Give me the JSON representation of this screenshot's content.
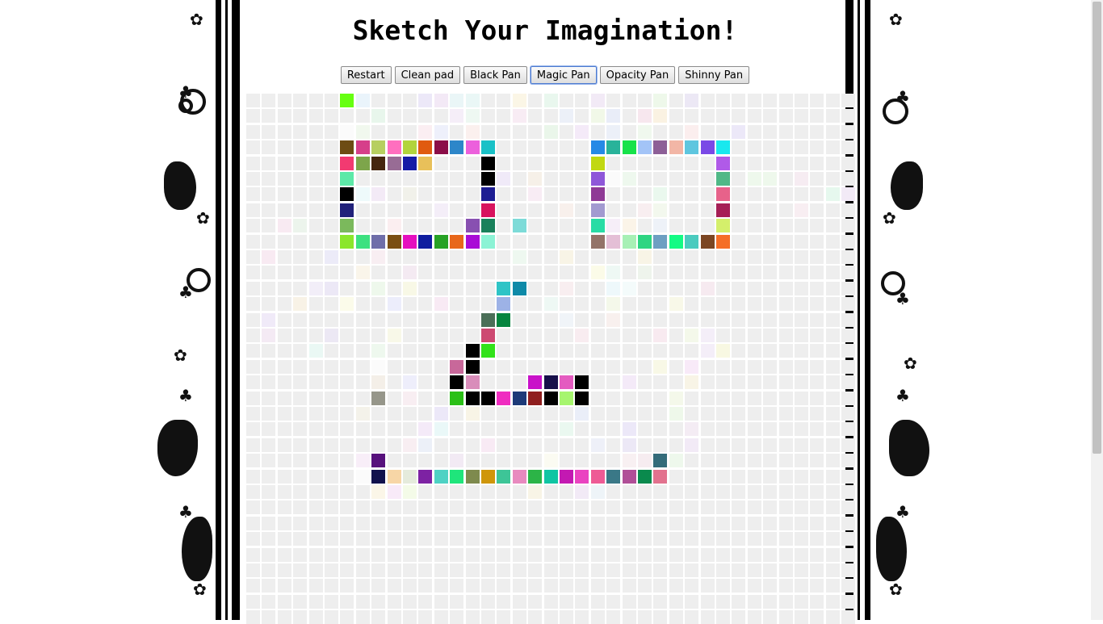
{
  "title": "Sketch Your Imagination!",
  "toolbar": {
    "restart_label": "Restart",
    "clean_label": "Clean pad",
    "black_label": "Black Pan",
    "magic_label": "Magic Pan",
    "opacity_label": "Opacity Pan",
    "shinny_label": "Shinny Pan",
    "active": "magic"
  },
  "grid": {
    "rows": 34,
    "cols": 39,
    "empty_color": "#eeeeee",
    "painted": [
      [
        0,
        6,
        "#66ff11"
      ],
      [
        3,
        6,
        "#6d4c13"
      ],
      [
        3,
        7,
        "#d63f8a"
      ],
      [
        3,
        8,
        "#b7cf60"
      ],
      [
        3,
        9,
        "#ff6fbf"
      ],
      [
        3,
        10,
        "#b2d43c"
      ],
      [
        3,
        11,
        "#e05a10"
      ],
      [
        3,
        12,
        "#8b0d48"
      ],
      [
        3,
        13,
        "#2d86c9"
      ],
      [
        3,
        14,
        "#ec60dc"
      ],
      [
        3,
        15,
        "#19c1c7"
      ],
      [
        3,
        22,
        "#2589e6"
      ],
      [
        3,
        23,
        "#29b39a"
      ],
      [
        3,
        24,
        "#16e24a"
      ],
      [
        3,
        25,
        "#a3c4f7"
      ],
      [
        3,
        26,
        "#8d5f97"
      ],
      [
        3,
        27,
        "#f2b6a6"
      ],
      [
        3,
        28,
        "#5ec6df"
      ],
      [
        3,
        29,
        "#7a49e6"
      ],
      [
        3,
        30,
        "#19e8ee"
      ],
      [
        4,
        6,
        "#f23a71"
      ],
      [
        4,
        7,
        "#7da54b"
      ],
      [
        4,
        8,
        "#45260f"
      ],
      [
        4,
        9,
        "#986c95"
      ],
      [
        4,
        10,
        "#161aa6"
      ],
      [
        4,
        11,
        "#e8c05a"
      ],
      [
        4,
        15,
        "#000000"
      ],
      [
        4,
        22,
        "#c1d811"
      ],
      [
        4,
        30,
        "#b05ae8"
      ],
      [
        5,
        6,
        "#5de9a8"
      ],
      [
        5,
        15,
        "#000000"
      ],
      [
        5,
        22,
        "#8f57d9"
      ],
      [
        5,
        30,
        "#50b887"
      ],
      [
        6,
        6,
        "#000000"
      ],
      [
        6,
        15,
        "#1d1d93"
      ],
      [
        6,
        22,
        "#8f3a96"
      ],
      [
        6,
        30,
        "#e7628a"
      ],
      [
        7,
        6,
        "#21217a"
      ],
      [
        7,
        15,
        "#d8135e"
      ],
      [
        7,
        22,
        "#a29ad0"
      ],
      [
        7,
        30,
        "#a61f56"
      ],
      [
        8,
        6,
        "#7bb95c"
      ],
      [
        8,
        14,
        "#8850b1"
      ],
      [
        8,
        15,
        "#19815b"
      ],
      [
        8,
        17,
        "#7ddbd8"
      ],
      [
        8,
        22,
        "#29dca5"
      ],
      [
        8,
        30,
        "#d4ef6b"
      ],
      [
        9,
        6,
        "#8be62b"
      ],
      [
        9,
        7,
        "#3de180"
      ],
      [
        9,
        8,
        "#6f6ea9"
      ],
      [
        9,
        9,
        "#7a4e12"
      ],
      [
        9,
        10,
        "#e50fbf"
      ],
      [
        9,
        11,
        "#0f1d9f"
      ],
      [
        9,
        12,
        "#27a225"
      ],
      [
        9,
        13,
        "#e8671a"
      ],
      [
        9,
        14,
        "#a90bd6"
      ],
      [
        9,
        15,
        "#8cf3d5"
      ],
      [
        9,
        22,
        "#937368"
      ],
      [
        9,
        23,
        "#e4bfd6"
      ],
      [
        9,
        24,
        "#a7f0b5"
      ],
      [
        9,
        25,
        "#2ed582"
      ],
      [
        9,
        26,
        "#6d9fc2"
      ],
      [
        9,
        27,
        "#14fb84"
      ],
      [
        9,
        28,
        "#4bcbbf"
      ],
      [
        9,
        29,
        "#7c4622"
      ],
      [
        9,
        30,
        "#f56e26"
      ],
      [
        12,
        16,
        "#2ec4c6"
      ],
      [
        12,
        17,
        "#0e8aa8"
      ],
      [
        13,
        16,
        "#9db2e6"
      ],
      [
        14,
        15,
        "#4b6f58"
      ],
      [
        14,
        16,
        "#06853f"
      ],
      [
        15,
        15,
        "#cd4a72"
      ],
      [
        16,
        14,
        "#000000"
      ],
      [
        16,
        15,
        "#32e21a"
      ],
      [
        17,
        13,
        "#c8689a"
      ],
      [
        17,
        14,
        "#000000"
      ],
      [
        18,
        13,
        "#000000"
      ],
      [
        18,
        14,
        "#d98dba"
      ],
      [
        18,
        18,
        "#c912c9"
      ],
      [
        18,
        19,
        "#170f4a"
      ],
      [
        18,
        20,
        "#e45bc0"
      ],
      [
        18,
        21,
        "#000000"
      ],
      [
        19,
        8,
        "#96968a"
      ],
      [
        19,
        13,
        "#2bc017"
      ],
      [
        19,
        14,
        "#000000"
      ],
      [
        19,
        15,
        "#000000"
      ],
      [
        19,
        16,
        "#ef2cc0"
      ],
      [
        19,
        17,
        "#1d3a78"
      ],
      [
        19,
        18,
        "#8f1e1e"
      ],
      [
        19,
        19,
        "#000000"
      ],
      [
        19,
        20,
        "#a6f56e"
      ],
      [
        19,
        21,
        "#000000"
      ],
      [
        23,
        8,
        "#57117c"
      ],
      [
        23,
        26,
        "#346c7a"
      ],
      [
        24,
        8,
        "#12124d"
      ],
      [
        24,
        9,
        "#f7d6a6"
      ],
      [
        24,
        10,
        "#e5ebdc"
      ],
      [
        24,
        11,
        "#7d22a3"
      ],
      [
        24,
        12,
        "#4ed2c4"
      ],
      [
        24,
        13,
        "#1fe57b"
      ],
      [
        24,
        14,
        "#7e8a4e"
      ],
      [
        24,
        15,
        "#cf960a"
      ],
      [
        24,
        16,
        "#3dc597"
      ],
      [
        24,
        17,
        "#e88abf"
      ],
      [
        24,
        18,
        "#2cb447"
      ],
      [
        24,
        19,
        "#10c5a3"
      ],
      [
        24,
        20,
        "#c319b2"
      ],
      [
        24,
        21,
        "#ea43c1"
      ],
      [
        24,
        22,
        "#ee5b95"
      ],
      [
        24,
        23,
        "#3a7887"
      ],
      [
        24,
        24,
        "#b04f97"
      ],
      [
        24,
        25,
        "#0a8a4d"
      ],
      [
        24,
        26,
        "#e2728e"
      ]
    ],
    "faint": [
      [
        0,
        7,
        "#eaf4fb"
      ],
      [
        0,
        11,
        "#ece8f8"
      ],
      [
        0,
        12,
        "#f3e9f6"
      ],
      [
        0,
        13,
        "#eaf6f7"
      ],
      [
        0,
        14,
        "#eaf7f6"
      ],
      [
        0,
        17,
        "#fbf6e6"
      ],
      [
        0,
        19,
        "#e9f7ee"
      ],
      [
        0,
        22,
        "#f2eaf6"
      ],
      [
        0,
        26,
        "#eef8ea"
      ],
      [
        0,
        28,
        "#ece8f5"
      ],
      [
        1,
        8,
        "#e8f6ec"
      ],
      [
        1,
        13,
        "#f5eef8"
      ],
      [
        1,
        14,
        "#eef8f2"
      ],
      [
        1,
        17,
        "#f8ecf4"
      ],
      [
        1,
        20,
        "#ecf0f8"
      ],
      [
        1,
        22,
        "#f1f8e8"
      ],
      [
        1,
        23,
        "#e9edf8"
      ],
      [
        1,
        25,
        "#f7e7ee"
      ],
      [
        1,
        26,
        "#faf2e2"
      ],
      [
        2,
        6,
        "#fbfbfb"
      ],
      [
        2,
        7,
        "#f1f8ee"
      ],
      [
        2,
        11,
        "#fbeef2"
      ],
      [
        2,
        12,
        "#eef0fb"
      ],
      [
        2,
        14,
        "#fbf0ee"
      ],
      [
        2,
        19,
        "#eaf6ea"
      ],
      [
        2,
        21,
        "#f4eaf8"
      ],
      [
        2,
        23,
        "#ecf0f8"
      ],
      [
        2,
        25,
        "#f0f8ee"
      ],
      [
        2,
        28,
        "#fbeeee"
      ],
      [
        2,
        31,
        "#ece8f8"
      ],
      [
        5,
        16,
        "#f0eaf8"
      ],
      [
        5,
        18,
        "#f6f0e8"
      ],
      [
        5,
        23,
        "#fbfbfb"
      ],
      [
        5,
        24,
        "#eef8ee"
      ],
      [
        5,
        32,
        "#eef8ec"
      ],
      [
        5,
        33,
        "#eef8ec"
      ],
      [
        5,
        35,
        "#f6ecf2"
      ],
      [
        6,
        7,
        "#eefafb"
      ],
      [
        6,
        8,
        "#f3eaf6"
      ],
      [
        6,
        10,
        "#f1f1ea"
      ],
      [
        6,
        18,
        "#f8ecf4"
      ],
      [
        6,
        26,
        "#eaf8ee"
      ],
      [
        6,
        37,
        "#e6f8ee"
      ],
      [
        6,
        38,
        "#f2eaf6"
      ],
      [
        7,
        12,
        "#f4eef8"
      ],
      [
        7,
        20,
        "#f8f0ec"
      ],
      [
        7,
        25,
        "#f8eef0"
      ],
      [
        7,
        26,
        "#f3f8ee"
      ],
      [
        7,
        35,
        "#f8eef2"
      ],
      [
        8,
        2,
        "#f8eaf2"
      ],
      [
        8,
        3,
        "#ecf4ec"
      ],
      [
        8,
        9,
        "#fbeef0"
      ],
      [
        8,
        23,
        "#f6eef8"
      ],
      [
        8,
        24,
        "#fbf4e8"
      ],
      [
        8,
        26,
        "#eef2f8"
      ],
      [
        10,
        1,
        "#f8eaf2"
      ],
      [
        10,
        5,
        "#ecebf8"
      ],
      [
        10,
        8,
        "#f8eef2"
      ],
      [
        10,
        17,
        "#eef8f0"
      ],
      [
        10,
        20,
        "#f8f4e6"
      ],
      [
        10,
        25,
        "#f8f4e6"
      ],
      [
        11,
        7,
        "#faf5ea"
      ],
      [
        11,
        10,
        "#f4eaf2"
      ],
      [
        11,
        22,
        "#fbfbe8"
      ],
      [
        11,
        23,
        "#eef8f4"
      ],
      [
        11,
        25,
        "#eef4ec"
      ],
      [
        12,
        4,
        "#f2eef8"
      ],
      [
        12,
        5,
        "#ece8f6"
      ],
      [
        12,
        8,
        "#eef8ec"
      ],
      [
        12,
        10,
        "#f8f8e6"
      ],
      [
        12,
        20,
        "#f8eef0"
      ],
      [
        12,
        23,
        "#eef8fb"
      ],
      [
        12,
        24,
        "#f4fbfb"
      ],
      [
        12,
        29,
        "#f6eaf0"
      ],
      [
        13,
        3,
        "#f8f2e6"
      ],
      [
        13,
        6,
        "#fbfbea"
      ],
      [
        13,
        9,
        "#ecedfb"
      ],
      [
        13,
        12,
        "#f8eaf4"
      ],
      [
        13,
        19,
        "#eef8f4"
      ],
      [
        13,
        23,
        "#f4f8ea"
      ],
      [
        13,
        27,
        "#f8f8e8"
      ],
      [
        14,
        1,
        "#f0eaf8"
      ],
      [
        14,
        20,
        "#f0f4f8"
      ],
      [
        14,
        23,
        "#f8f0ee"
      ],
      [
        15,
        1,
        "#f4eaf4"
      ],
      [
        15,
        5,
        "#ece8f4"
      ],
      [
        15,
        9,
        "#f8f8e8"
      ],
      [
        15,
        21,
        "#f8ecf0"
      ],
      [
        15,
        26,
        "#f8eaf0"
      ],
      [
        15,
        28,
        "#f4f8ea"
      ],
      [
        15,
        29,
        "#f4eef8"
      ],
      [
        16,
        4,
        "#eaf8f4"
      ],
      [
        16,
        8,
        "#eef8ee"
      ],
      [
        16,
        30,
        "#f8f8e2"
      ],
      [
        16,
        29,
        "#f4eef8"
      ],
      [
        17,
        8,
        "#fbfbfb"
      ],
      [
        17,
        28,
        "#f8eaf8"
      ],
      [
        17,
        26,
        "#f8f8e6"
      ],
      [
        18,
        8,
        "#f4efe8"
      ],
      [
        18,
        10,
        "#eeeefb"
      ],
      [
        18,
        24,
        "#f4eaf8"
      ],
      [
        18,
        28,
        "#f8f4e6"
      ],
      [
        19,
        10,
        "#f8eef2"
      ],
      [
        19,
        27,
        "#f4f8ea"
      ],
      [
        20,
        7,
        "#f4f2ea"
      ],
      [
        20,
        12,
        "#ece8f8"
      ],
      [
        20,
        14,
        "#f8f4e6"
      ],
      [
        20,
        21,
        "#eaeef8"
      ],
      [
        20,
        27,
        "#eef8ea"
      ],
      [
        21,
        11,
        "#f4eaf8"
      ],
      [
        21,
        12,
        "#eaf8f8"
      ],
      [
        21,
        20,
        "#eaf8f0"
      ],
      [
        21,
        24,
        "#ece8f8"
      ],
      [
        21,
        28,
        "#f4ecf4"
      ],
      [
        22,
        10,
        "#f8eef2"
      ],
      [
        22,
        11,
        "#ecf0f8"
      ],
      [
        22,
        15,
        "#f8eaf4"
      ],
      [
        22,
        22,
        "#eef0f8"
      ],
      [
        22,
        24,
        "#ece8f6"
      ],
      [
        22,
        28,
        "#f2eaf6"
      ],
      [
        23,
        7,
        "#f8eef8"
      ],
      [
        23,
        13,
        "#f2eaf4"
      ],
      [
        23,
        19,
        "#fbfbf2"
      ],
      [
        23,
        24,
        "#f8f0f2"
      ],
      [
        23,
        25,
        "#f6ecf0"
      ],
      [
        23,
        27,
        "#eef8ec"
      ],
      [
        24,
        7,
        "#fbfbfb"
      ],
      [
        25,
        8,
        "#fbf6e8"
      ],
      [
        25,
        9,
        "#f8eaf8"
      ],
      [
        25,
        10,
        "#f4fbe8"
      ],
      [
        25,
        18,
        "#f8f4e6"
      ],
      [
        25,
        21,
        "#f2eaf6"
      ],
      [
        25,
        22,
        "#eef4f8"
      ]
    ]
  }
}
